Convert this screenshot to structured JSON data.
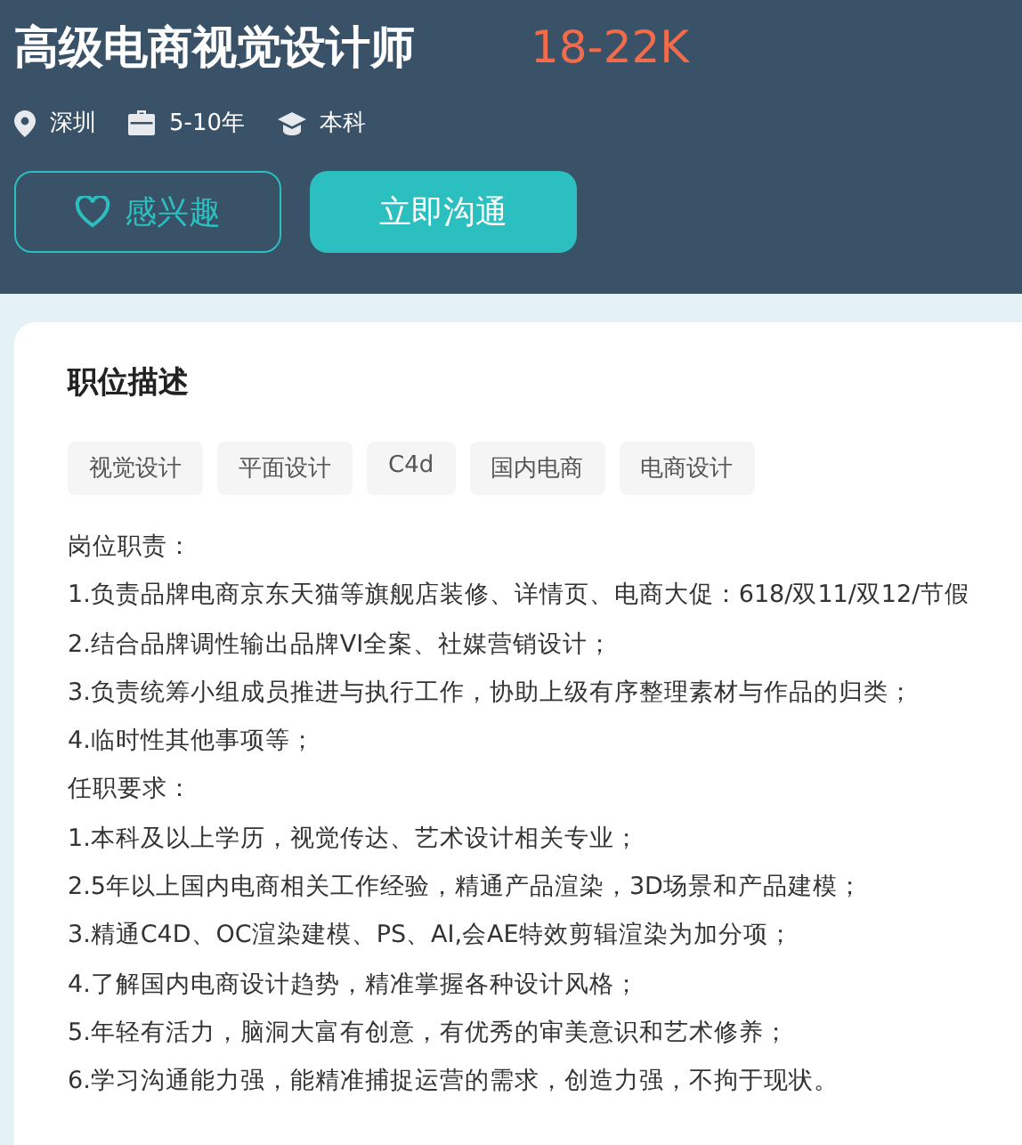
{
  "job": {
    "title": "高级电商视觉设计师",
    "salary": "18-22K"
  },
  "meta": [
    {
      "kind": "location",
      "text": "深圳"
    },
    {
      "kind": "experience",
      "text": "5-10年"
    },
    {
      "kind": "education",
      "text": "本科"
    }
  ],
  "buttons": [
    {
      "kind": "interest",
      "label": "感兴趣"
    },
    {
      "kind": "chat",
      "label": "立即沟通"
    }
  ],
  "description": {
    "heading": "职位描述",
    "tags": [
      "视觉设计",
      "平面设计",
      "C4d",
      "国内电商",
      "电商设计"
    ],
    "lines": [
      "岗位职责：",
      "1.负责品牌电商京东天猫等旗舰店装修、详情页、电商大促：618/双11/双12/节假",
      "2.结合品牌调性输出品牌VI全案、社媒营销设计；",
      "3.负责统筹小组成员推进与执行工作，协助上级有序整理素材与作品的归类；",
      "4.临时性其他事项等；",
      "任职要求：",
      "1.本科及以上学历，视觉传达、艺术设计相关专业；",
      "2.5年以上国内电商相关工作经验，精通产品渲染，3D场景和产品建模；",
      "3.精通C4D、OC渲染建模、PS、AI,会AE特效剪辑渲染为加分项；",
      "4.了解国内电商设计趋势，精准掌握各种设计风格；",
      "5.年轻有活力，脑洞大富有创意，有优秀的审美意识和艺术修养；",
      "6.学习沟通能力强，能精准捕捉运营的需求，创造力强，不拘于现状。"
    ]
  }
}
